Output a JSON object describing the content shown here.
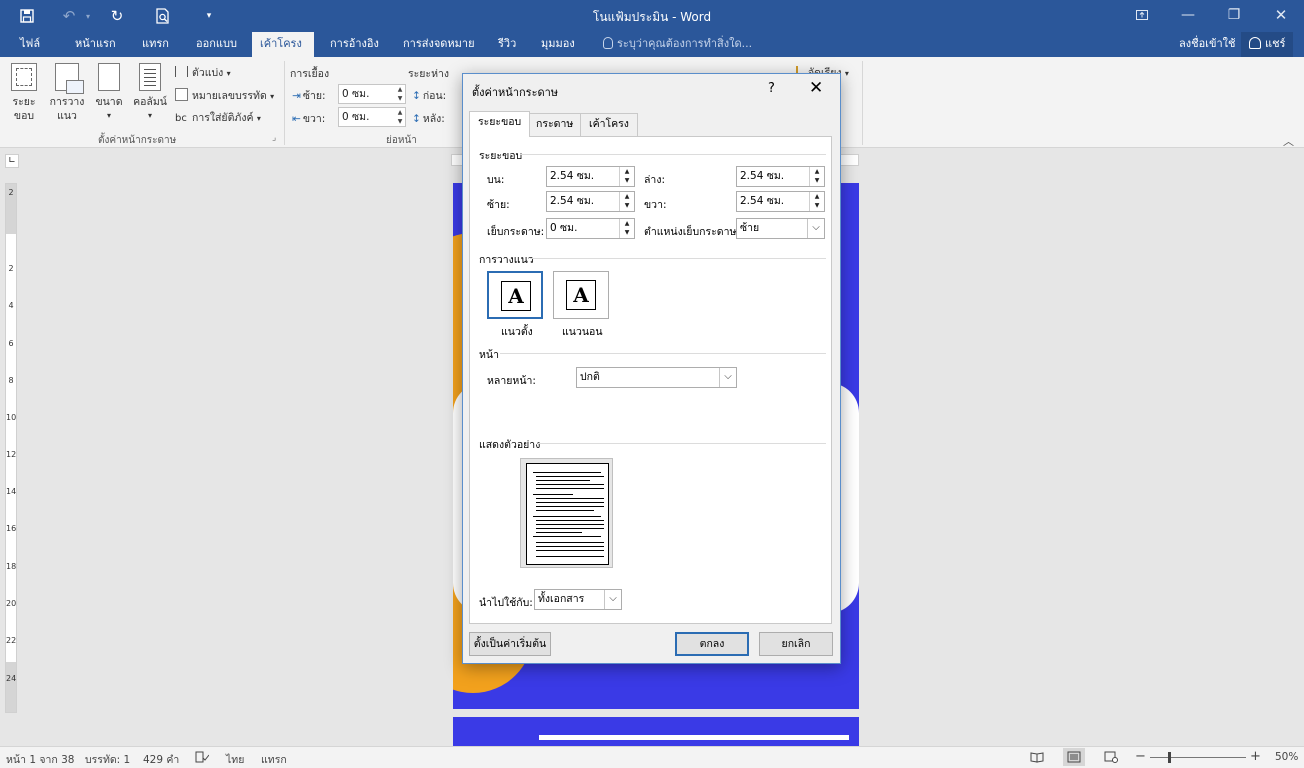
{
  "window": {
    "title": "โนแฟ้มประมิน - Word",
    "sign_in": "ลงชื่อเข้าใช้",
    "share": "แชร์"
  },
  "ribbon_tabs": [
    "ไฟล์",
    "หน้าแรก",
    "แทรก",
    "ออกแบบ",
    "เค้าโครง",
    "การอ้างอิง",
    "การส่งจดหมาย",
    "รีวิว",
    "มุมมอง"
  ],
  "tell_me": "ระบุว่าคุณต้องการทำสิ่งใด...",
  "ribbon": {
    "margins_line1": "ระยะ",
    "margins_line2": "ขอบ",
    "orientation_line1": "การวาง",
    "orientation_line2": "แนว",
    "size_label": "ขนาด",
    "columns_label": "คอลัมน์",
    "breaks_label": "ตัวแบ่ง",
    "line_numbers_label": "หมายเลขบรรทัด",
    "hyphenation_label": "การใส่ยัติภังค์",
    "page_setup_group": "ตั้งค่าหน้ากระดาษ",
    "indent_header": "การเยื้อง",
    "spacing_header": "ระยะห่าง",
    "indent_left_label": "ซ้าย:",
    "indent_left_value": "0 ซม.",
    "indent_right_label": "ขวา:",
    "indent_right_value": "0 ซม.",
    "spacing_before_label": "ก่อน:",
    "spacing_after_label": "หลัง:",
    "paragraph_group": "ย่อหน้า",
    "align_label": "จัดเรียง"
  },
  "ruler": {
    "vertical_numbers": [
      "2",
      "2",
      "4",
      "6",
      "8",
      "10",
      "12",
      "14",
      "16",
      "18",
      "20",
      "22",
      "24"
    ]
  },
  "status_bar": {
    "page": "หน้า 1 จาก 38",
    "line": "บรรทัด: 1",
    "words": "429 คำ",
    "language": "ไทย",
    "mode": "แทรก",
    "zoom": "50%"
  },
  "dialog": {
    "title": "ตั้งค่าหน้ากระดาษ",
    "help": "?",
    "tabs": [
      "ระยะขอบ",
      "กระดาษ",
      "เค้าโครง"
    ],
    "margins_section": "ระยะขอบ",
    "top_label": "บน:",
    "top_value": "2.54 ซม.",
    "bottom_label": "ล่าง:",
    "bottom_value": "2.54 ซม.",
    "left_label": "ซ้าย:",
    "left_value": "2.54 ซม.",
    "right_label": "ขวา:",
    "right_value": "2.54 ซม.",
    "gutter_label": "เย็บกระดาษ:",
    "gutter_value": "0 ซม.",
    "gutter_pos_label": "ตำแหน่งเย็บกระดาษ:",
    "gutter_pos_value": "ซ้าย",
    "orientation_section": "การวางแนว",
    "portrait_label": "แนวตั้ง",
    "landscape_label": "แนวนอน",
    "pages_section": "หน้า",
    "multiple_pages_label": "หลายหน้า:",
    "multiple_pages_value": "ปกติ",
    "preview_section": "แสดงตัวอย่าง",
    "apply_to_label": "นำไปใช้กับ:",
    "apply_to_value": "ทั้งเอกสาร",
    "set_default_button": "ตั้งเป็นค่าเริ่มต้น",
    "ok_button": "ตกลง",
    "cancel_button": "ยกเลิก"
  },
  "colors": {
    "word_blue": "#2b579a",
    "dialog_accent": "#2b6cb3",
    "page_blue": "#3a3ae6",
    "page_orange": "#f2a11d"
  }
}
